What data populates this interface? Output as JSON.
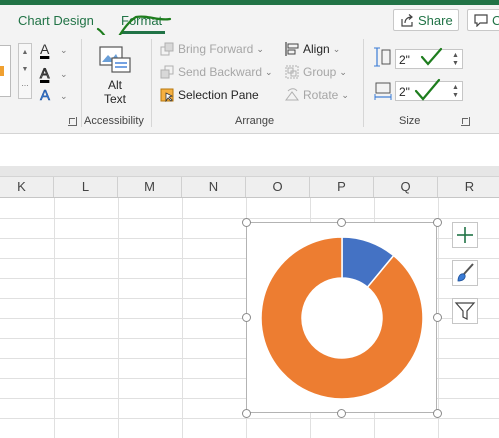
{
  "tabs": {
    "chart_design": "Chart Design",
    "format": "Format"
  },
  "header": {
    "share": "Share",
    "comments": "C"
  },
  "ribbon": {
    "accessibility": {
      "alt_text_line1": "Alt",
      "alt_text_line2": "Text",
      "group_label": "Accessibility"
    },
    "arrange": {
      "bring_forward": "Bring Forward",
      "send_backward": "Send Backward",
      "selection_pane": "Selection Pane",
      "align": "Align",
      "group": "Group",
      "rotate": "Rotate",
      "group_label": "Arrange"
    },
    "size": {
      "height": "2\"",
      "width": "2\"",
      "group_label": "Size"
    }
  },
  "columns": [
    "K",
    "L",
    "M",
    "N",
    "O",
    "P",
    "Q",
    "R"
  ],
  "chart_data": {
    "type": "pie",
    "variant": "doughnut",
    "values": [
      11,
      89
    ],
    "colors": [
      "#4472c4",
      "#ed7d31"
    ]
  },
  "colors": {
    "accent": "#217346",
    "annotation_check": "#1e7d1e"
  },
  "icons": {
    "chart_elements": "plus-icon",
    "chart_styles": "paintbrush-icon",
    "chart_filters": "funnel-icon"
  }
}
